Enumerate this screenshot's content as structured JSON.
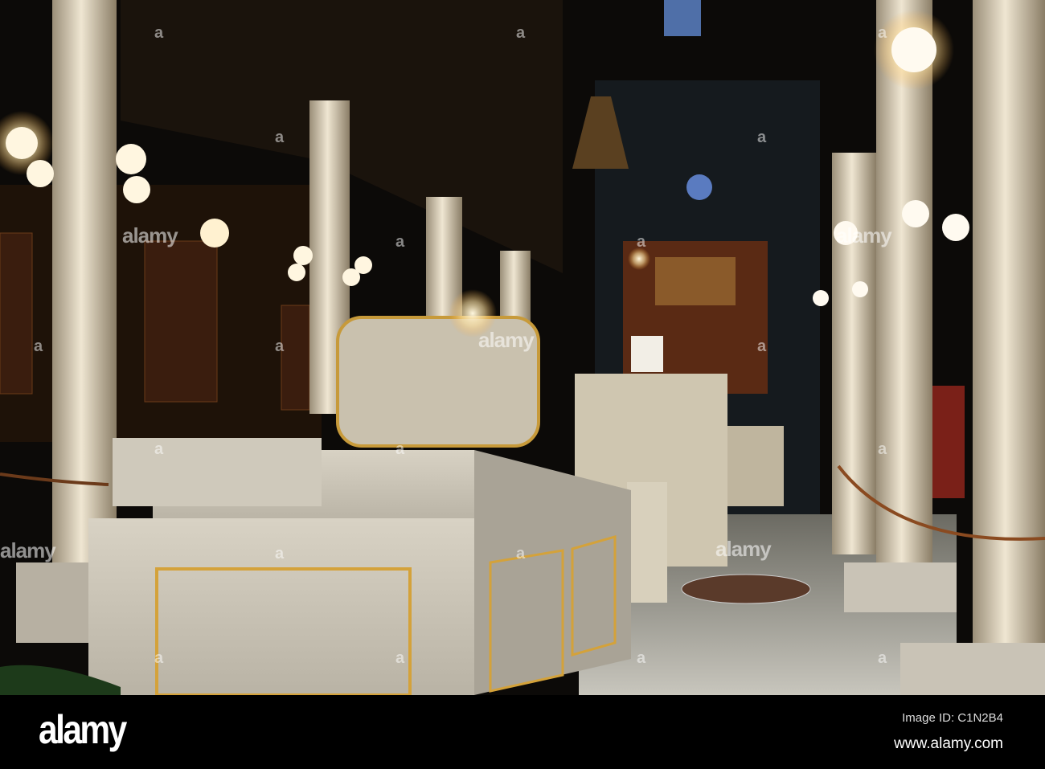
{
  "photo": {
    "subject": "synagogue-interior",
    "watermark_word": "alamy",
    "watermark_letter": "a"
  },
  "footer": {
    "logo": "alamy",
    "image_id": "Image ID: C1N2B4",
    "url": "www.alamy.com"
  }
}
